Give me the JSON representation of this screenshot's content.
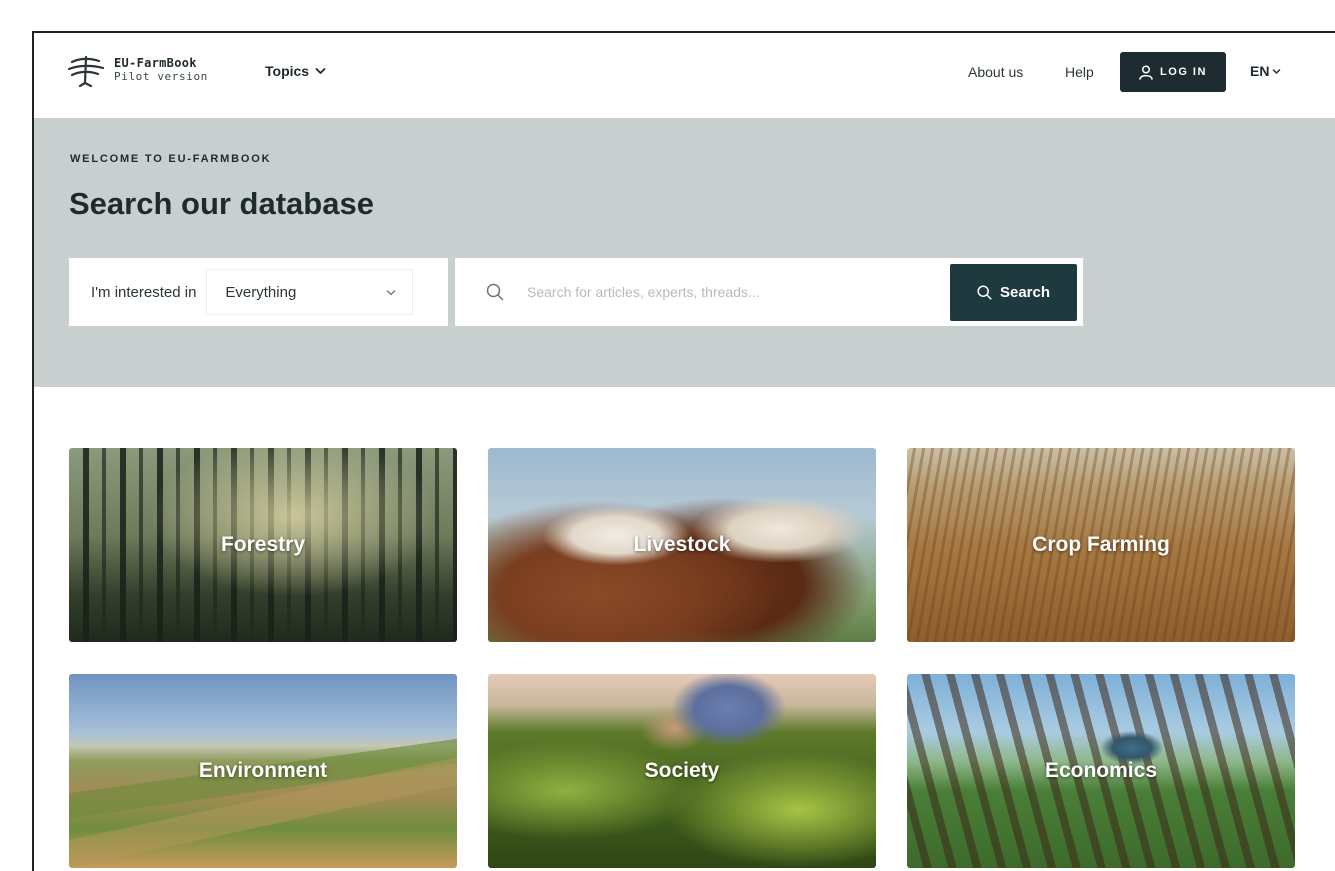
{
  "header": {
    "logo_name": "EU-FarmBook",
    "logo_subtitle": "Pilot version",
    "topics_label": "Topics",
    "about_label": "About us",
    "help_label": "Help",
    "login_label": "LOG IN",
    "language": "EN"
  },
  "hero": {
    "eyebrow": "WELCOME TO EU-FARMBOOK",
    "title": "Search our database",
    "interest_label": "I'm interested in",
    "category_value": "Everything",
    "search_placeholder": "Search for articles, experts, threads...",
    "search_button": "Search"
  },
  "topics": [
    {
      "label": "Forestry"
    },
    {
      "label": "Livestock"
    },
    {
      "label": "Crop Farming"
    },
    {
      "label": "Environment"
    },
    {
      "label": "Society"
    },
    {
      "label": "Economics"
    }
  ],
  "colors": {
    "hero_background": "#c7d0cf",
    "login_button": "#1e2b31",
    "search_button": "#1e3a3e",
    "text_dark": "#1f2a2e"
  },
  "icons": {
    "logo": "farmbook-logo-icon",
    "topics_caret": "chevron-down-icon",
    "login": "user-icon",
    "language_caret": "chevron-down-icon",
    "select_caret": "chevron-down-icon",
    "search_field": "search-icon",
    "search_button": "search-icon"
  }
}
